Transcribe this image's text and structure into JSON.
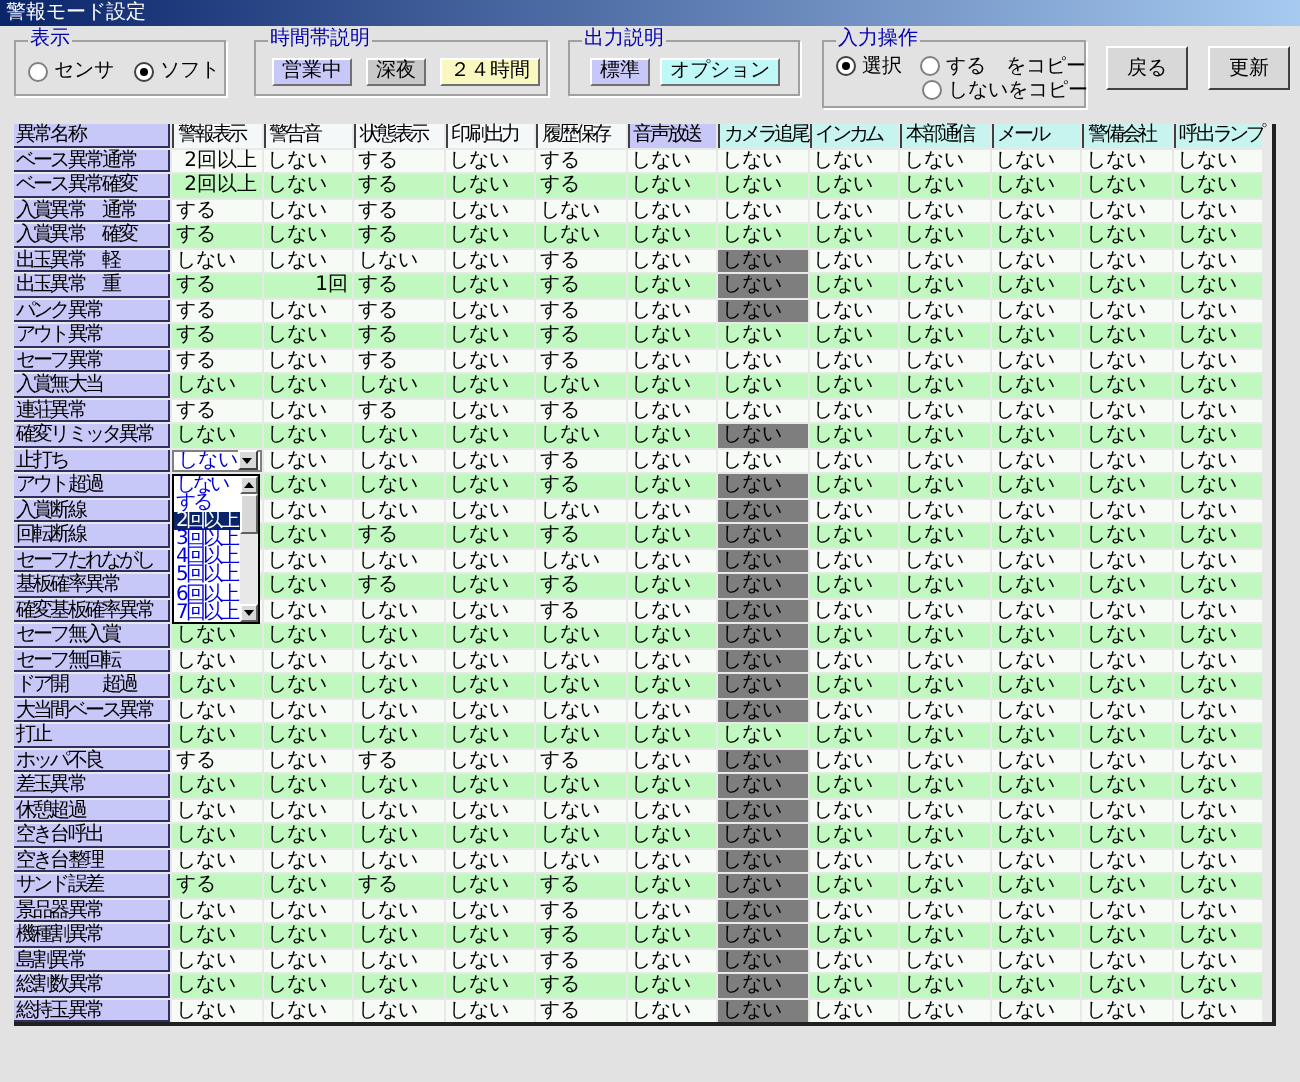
{
  "window": {
    "title": "警報モード設定"
  },
  "display_group": {
    "label": "表示",
    "options": [
      {
        "label": "センサ",
        "selected": false
      },
      {
        "label": "ソフト",
        "selected": true
      }
    ]
  },
  "time_legend": {
    "label": "時間帯説明",
    "chips": [
      {
        "label": "営業中",
        "color": "#c8c8f8"
      },
      {
        "label": "深夜",
        "color": "#c8c8c8"
      },
      {
        "label": "２４時間",
        "color": "#f8f8c0"
      }
    ]
  },
  "output_legend": {
    "label": "出力説明",
    "chips": [
      {
        "label": "標準",
        "color": "#c8c8f8"
      },
      {
        "label": "オプション",
        "color": "#c0f8f8"
      }
    ]
  },
  "input_group": {
    "label": "入力操作",
    "options": [
      {
        "label": "選択",
        "selected": true
      },
      {
        "label": "する　をコピー",
        "selected": false
      },
      {
        "label": "しないをコピー",
        "selected": false
      }
    ]
  },
  "buttons": [
    "戻る",
    "更新"
  ],
  "table": {
    "name_header": "異常名称",
    "columns": [
      {
        "label": "警報表示",
        "kind": "plain"
      },
      {
        "label": "警告音",
        "kind": "plain"
      },
      {
        "label": "状態表示",
        "kind": "plain"
      },
      {
        "label": "印刷出力",
        "kind": "plain"
      },
      {
        "label": "履歴保存",
        "kind": "plain"
      },
      {
        "label": "音声放送",
        "kind": "standard"
      },
      {
        "label": "カメラ追尾",
        "kind": "option"
      },
      {
        "label": "インカム",
        "kind": "option"
      },
      {
        "label": "本部通信",
        "kind": "option"
      },
      {
        "label": "メール",
        "kind": "option"
      },
      {
        "label": "警備会社",
        "kind": "option"
      },
      {
        "label": "呼出ランプ",
        "kind": "option"
      }
    ],
    "rows": [
      {
        "name": "ベース異常通常",
        "grayed": false,
        "cells": [
          {
            "text": "2回以上",
            "kind": "count"
          },
          "しない",
          "する",
          "しない",
          "する",
          "しない",
          "しない",
          "しない",
          "しない",
          "しない",
          "しない",
          "しない"
        ]
      },
      {
        "name": "ベース異常確変",
        "grayed": false,
        "cells": [
          {
            "text": "2回以上",
            "kind": "count"
          },
          "しない",
          "する",
          "しない",
          "する",
          "しない",
          "しない",
          "しない",
          "しない",
          "しない",
          "しない",
          "しない"
        ]
      },
      {
        "name": "入賞異常　通常",
        "grayed": false,
        "cells": [
          "する",
          "しない",
          "する",
          "しない",
          "しない",
          "しない",
          "しない",
          "しない",
          "しない",
          "しない",
          "しない",
          "しない"
        ]
      },
      {
        "name": "入賞異常　確変",
        "grayed": false,
        "cells": [
          "する",
          "しない",
          "する",
          "しない",
          "しない",
          "しない",
          "しない",
          "しない",
          "しない",
          "しない",
          "しない",
          "しない"
        ]
      },
      {
        "name": "出玉異常　軽",
        "grayed": true,
        "cells": [
          "しない",
          "しない",
          "しない",
          "しない",
          "する",
          "しない",
          "しない",
          "しない",
          "しない",
          "しない",
          "しない",
          "しない"
        ]
      },
      {
        "name": "出玉異常　重",
        "grayed": true,
        "cells": [
          "する",
          {
            "text": "1回",
            "kind": "count"
          },
          "する",
          "しない",
          "する",
          "しない",
          "しない",
          "しない",
          "しない",
          "しない",
          "しない",
          "しない"
        ]
      },
      {
        "name": "パンク異常",
        "grayed": true,
        "cells": [
          "する",
          "しない",
          "する",
          "しない",
          "する",
          "しない",
          "しない",
          "しない",
          "しない",
          "しない",
          "しない",
          "しない"
        ]
      },
      {
        "name": "アウト異常",
        "grayed": false,
        "cells": [
          "する",
          "しない",
          "する",
          "しない",
          "する",
          "しない",
          "しない",
          "しない",
          "しない",
          "しない",
          "しない",
          "しない"
        ]
      },
      {
        "name": "セーフ異常",
        "grayed": false,
        "cells": [
          "する",
          "しない",
          "する",
          "しない",
          "する",
          "しない",
          "しない",
          "しない",
          "しない",
          "しない",
          "しない",
          "しない"
        ]
      },
      {
        "name": "入賞無大当",
        "grayed": false,
        "cells": [
          "しない",
          "しない",
          "しない",
          "しない",
          "しない",
          "しない",
          "しない",
          "しない",
          "しない",
          "しない",
          "しない",
          "しない"
        ]
      },
      {
        "name": "連荘異常",
        "grayed": false,
        "cells": [
          "する",
          "しない",
          "する",
          "しない",
          "する",
          "しない",
          "しない",
          "しない",
          "しない",
          "しない",
          "しない",
          "しない"
        ]
      },
      {
        "name": "確変リミッタ異常",
        "grayed": true,
        "cells": [
          "しない",
          "しない",
          "しない",
          "しない",
          "しない",
          "しない",
          "しない",
          "しない",
          "しない",
          "しない",
          "しない",
          "しない"
        ]
      },
      {
        "name": "止打ち",
        "grayed": false,
        "cells": [
          {
            "text": "しない",
            "kind": "combo"
          },
          "しない",
          "しない",
          "しない",
          "する",
          "しない",
          "しない",
          "しない",
          "しない",
          "しない",
          "しない",
          "しない"
        ]
      },
      {
        "name": "アウト超過",
        "grayed": true,
        "cells": [
          null,
          "しない",
          "しない",
          "しない",
          "する",
          "しない",
          "しない",
          "しない",
          "しない",
          "しない",
          "しない",
          "しない"
        ]
      },
      {
        "name": "入賞断線",
        "grayed": true,
        "cells": [
          null,
          "しない",
          "しない",
          "しない",
          "しない",
          "しない",
          "しない",
          "しない",
          "しない",
          "しない",
          "しない",
          "しない"
        ]
      },
      {
        "name": "回転断線",
        "grayed": true,
        "cells": [
          null,
          "しない",
          "する",
          "しない",
          "する",
          "しない",
          "しない",
          "しない",
          "しない",
          "しない",
          "しない",
          "しない"
        ]
      },
      {
        "name": "セーフたれながし",
        "grayed": true,
        "cells": [
          null,
          "しない",
          "しない",
          "しない",
          "しない",
          "しない",
          "しない",
          "しない",
          "しない",
          "しない",
          "しない",
          "しない"
        ]
      },
      {
        "name": "基板確率異常",
        "grayed": true,
        "cells": [
          null,
          "しない",
          "する",
          "しない",
          "する",
          "しない",
          "しない",
          "しない",
          "しない",
          "しない",
          "しない",
          "しない"
        ]
      },
      {
        "name": "確変基板確率異常",
        "grayed": true,
        "cells": [
          null,
          "しない",
          "しない",
          "しない",
          "する",
          "しない",
          "しない",
          "しない",
          "しない",
          "しない",
          "しない",
          "しない"
        ]
      },
      {
        "name": "セーフ無入賞",
        "grayed": true,
        "cells": [
          "しない",
          "しない",
          "しない",
          "しない",
          "しない",
          "しない",
          "しない",
          "しない",
          "しない",
          "しない",
          "しない",
          "しない"
        ]
      },
      {
        "name": "セーフ無回転",
        "grayed": true,
        "cells": [
          "しない",
          "しない",
          "しない",
          "しない",
          "しない",
          "しない",
          "しない",
          "しない",
          "しない",
          "しない",
          "しない",
          "しない"
        ]
      },
      {
        "name": "ドア開　　超過",
        "grayed": true,
        "cells": [
          "しない",
          "しない",
          "しない",
          "しない",
          "しない",
          "しない",
          "しない",
          "しない",
          "しない",
          "しない",
          "しない",
          "しない"
        ]
      },
      {
        "name": "大当間ベース異常",
        "grayed": true,
        "cells": [
          "しない",
          "しない",
          "しない",
          "しない",
          "しない",
          "しない",
          "しない",
          "しない",
          "しない",
          "しない",
          "しない",
          "しない"
        ]
      },
      {
        "name": "打止",
        "grayed": false,
        "cells": [
          "しない",
          "しない",
          "しない",
          "しない",
          "しない",
          "しない",
          "しない",
          "しない",
          "しない",
          "しない",
          "しない",
          "しない"
        ]
      },
      {
        "name": "ホッパ不良",
        "grayed": true,
        "cells": [
          "する",
          "しない",
          "する",
          "しない",
          "する",
          "しない",
          "しない",
          "しない",
          "しない",
          "しない",
          "しない",
          "しない"
        ]
      },
      {
        "name": "差玉異常",
        "grayed": true,
        "cells": [
          "しない",
          "しない",
          "しない",
          "しない",
          "しない",
          "しない",
          "しない",
          "しない",
          "しない",
          "しない",
          "しない",
          "しない"
        ]
      },
      {
        "name": "休憩超過",
        "grayed": true,
        "cells": [
          "しない",
          "しない",
          "しない",
          "しない",
          "しない",
          "しない",
          "しない",
          "しない",
          "しない",
          "しない",
          "しない",
          "しない"
        ]
      },
      {
        "name": "空き台呼出",
        "grayed": true,
        "cells": [
          "しない",
          "しない",
          "しない",
          "しない",
          "しない",
          "しない",
          "しない",
          "しない",
          "しない",
          "しない",
          "しない",
          "しない"
        ]
      },
      {
        "name": "空き台整理",
        "grayed": true,
        "cells": [
          "しない",
          "しない",
          "しない",
          "しない",
          "しない",
          "しない",
          "しない",
          "しない",
          "しない",
          "しない",
          "しない",
          "しない"
        ]
      },
      {
        "name": "サンド誤差",
        "grayed": true,
        "cells": [
          "する",
          "しない",
          "する",
          "しない",
          "する",
          "しない",
          "しない",
          "しない",
          "しない",
          "しない",
          "しない",
          "しない"
        ]
      },
      {
        "name": "景品器異常",
        "grayed": true,
        "cells": [
          "しない",
          "しない",
          "しない",
          "しない",
          "する",
          "しない",
          "しない",
          "しない",
          "しない",
          "しない",
          "しない",
          "しない"
        ]
      },
      {
        "name": "機種割異常",
        "grayed": true,
        "cells": [
          "しない",
          "しない",
          "しない",
          "しない",
          "する",
          "しない",
          "しない",
          "しない",
          "しない",
          "しない",
          "しない",
          "しない"
        ]
      },
      {
        "name": "島割異常",
        "grayed": true,
        "cells": [
          "しない",
          "しない",
          "しない",
          "しない",
          "する",
          "しない",
          "しない",
          "しない",
          "しない",
          "しない",
          "しない",
          "しない"
        ]
      },
      {
        "name": "総割数異常",
        "grayed": true,
        "cells": [
          "しない",
          "しない",
          "しない",
          "しない",
          "する",
          "しない",
          "しない",
          "しない",
          "しない",
          "しない",
          "しない",
          "しない"
        ]
      },
      {
        "name": "総持玉異常",
        "grayed": true,
        "cells": [
          "しない",
          "しない",
          "しない",
          "しない",
          "する",
          "しない",
          "しない",
          "しない",
          "しない",
          "しない",
          "しない",
          "しない"
        ]
      }
    ]
  },
  "dropdown": {
    "options": [
      {
        "label": "しない",
        "selected": false
      },
      {
        "label": "する",
        "selected": false
      },
      {
        "label": "2回以上",
        "selected": true
      },
      {
        "label": "3回以上",
        "selected": false
      },
      {
        "label": "4回以上",
        "selected": false
      },
      {
        "label": "5回以上",
        "selected": false
      },
      {
        "label": "6回以上",
        "selected": false
      },
      {
        "label": "7回以上",
        "selected": false
      }
    ]
  }
}
